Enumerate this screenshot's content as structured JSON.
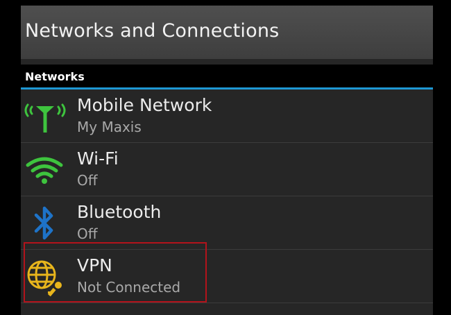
{
  "header": {
    "title": "Networks and Connections"
  },
  "section": {
    "label": "Networks"
  },
  "items": [
    {
      "label": "Mobile Network",
      "status": "My Maxis",
      "icon": "cell-tower-icon"
    },
    {
      "label": "Wi-Fi",
      "status": "Off",
      "icon": "wifi-icon"
    },
    {
      "label": "Bluetooth",
      "status": "Off",
      "icon": "bluetooth-icon"
    },
    {
      "label": "VPN",
      "status": "Not Connected",
      "icon": "vpn-globe-key-icon"
    }
  ],
  "colors": {
    "accent": "#1e98d4",
    "green": "#3ec43e",
    "bluetooth": "#1e73c8",
    "vpn": "#e8b51c",
    "highlight": "#b3131b"
  }
}
